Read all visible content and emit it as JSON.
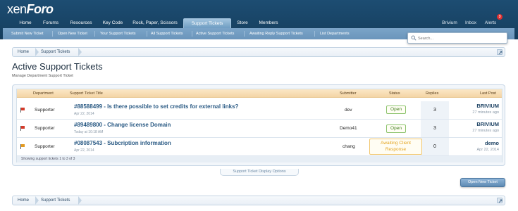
{
  "logo": {
    "text_a": "xen",
    "text_b": "Foro"
  },
  "nav": {
    "tabs": [
      "Home",
      "Forums",
      "Resources",
      "Key Code",
      "Rock, Paper, Scissors",
      "Support Tickets",
      "Store",
      "Members"
    ],
    "right": [
      "Brivium",
      "Inbox",
      "Alerts"
    ],
    "alerts_count": "3"
  },
  "subnav": [
    "Submit New Ticket",
    "Open New Ticket",
    "Your Support Tickets",
    "All Support Tickets",
    "Active Support Tickets",
    "Awaiting Reply Support Tickets",
    "List Departments"
  ],
  "search": {
    "placeholder": "Search..."
  },
  "breadcrumb": [
    "Home",
    "Support Tickets"
  ],
  "page": {
    "title": "Active Support Tickets",
    "description": "Manage Department Support Ticket"
  },
  "table": {
    "headers": {
      "department": "Department",
      "title": "Support Ticket Title",
      "submitter": "Submitter",
      "status": "Status",
      "replies": "Replies",
      "last_post": "Last Post"
    },
    "rows": [
      {
        "department": "Supporter",
        "title": "#88588499 - Is there possible to set credits for external links?",
        "date": "Apr 22, 2014",
        "submitter": "dev",
        "status_line1": "Open",
        "status_line2": "",
        "replies": "3",
        "last_name": "BRIVIUM",
        "last_time": "27 minutes ago",
        "flag_color": "#d23a2a"
      },
      {
        "department": "Supporter",
        "title": "#89489800 - Change license Domain",
        "date": "Today at 10:18 AM",
        "submitter": "Demo41",
        "status_line1": "Open",
        "status_line2": "",
        "replies": "3",
        "last_name": "BRIVIUM",
        "last_time": "27 minutes ago",
        "flag_color": "#d23a2a"
      },
      {
        "department": "Supporter",
        "title": "#08087543 - Subcription information",
        "date": "Apr 22, 2014",
        "submitter": "chang",
        "status_line1": "Awaiting Client",
        "status_line2": "Response",
        "replies": "0",
        "last_name": "demo",
        "last_time": "Apr 22, 2014",
        "flag_color": "#e39a20"
      }
    ],
    "showing": "Showing support tickets 1 to 3 of 3"
  },
  "display_options": "Support Ticket Display Options",
  "open_new_ticket": "Open New Ticket"
}
